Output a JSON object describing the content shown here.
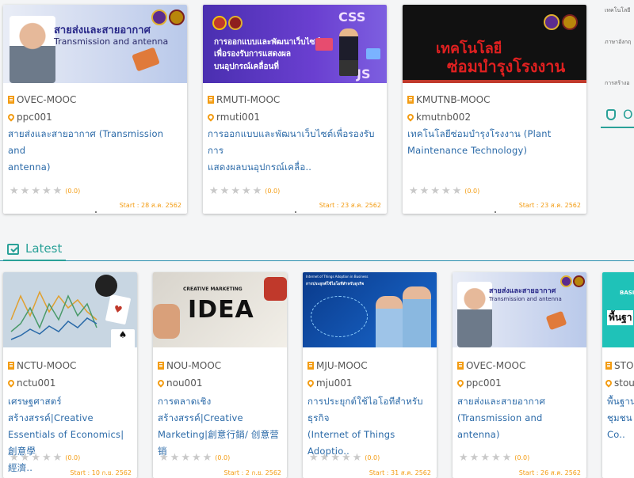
{
  "top_courses": [
    {
      "institution": "OVEC-MOOC",
      "code": "ppc001",
      "title_line1": "สายส่งและสายอากาศ (Transmission and",
      "title_line2": "antenna)",
      "rating": "(0.0)",
      "start": "Start : 28 ส.ค. 2562",
      "thumb_text1": "สายส่งและสายอากาศ",
      "thumb_text2": "Transmission and antenna"
    },
    {
      "institution": "RMUTI-MOOC",
      "code": "rmuti001",
      "title_line1": "การออกแบบและพัฒนาเว็บไซต์เพื่อรองรับการ",
      "title_line2": "แสดงผลบนอุปกรณ์เคลื่อ..",
      "rating": "(0.0)",
      "start": "Start : 23 ส.ค. 2562",
      "thumb_text1": "การออกแบบและพัฒนาเว็บไซต์",
      "thumb_text2": "เพื่อรองรับการแสดงผล",
      "thumb_text3": "บนอุปกรณ์เคลื่อนที่",
      "thumb_css": "CSS",
      "thumb_js": "JS"
    },
    {
      "institution": "KMUTNB-MOOC",
      "code": "kmutnb002",
      "title_line1": "เทคโนโลยีซ่อมบำรุงโรงงาน (Plant",
      "title_line2": "Maintenance Technology)",
      "rating": "(0.0)",
      "start": "Start : 23 ส.ค. 2562",
      "thumb_text1": "เทคโนโลยี",
      "thumb_text2": "ซ่อมบำรุงโรงงาน"
    }
  ],
  "side_panel": {
    "line1": "เทคโนโลยี",
    "line2": "ภาษาอังกฤ",
    "line3": "การสร้างอ",
    "online_label": "O"
  },
  "latest_section": {
    "title": "Latest"
  },
  "latest_courses": [
    {
      "institution": "NCTU-MOOC",
      "code": "nctu001",
      "title_line1": "เศรษฐศาสตร์สร้างสรรค์|Creative",
      "title_line2": "Essentials of Economics|創意學",
      "title_line3": "經濟..",
      "rating": "(0.0)",
      "start": "Start : 10 ก.ย. 2562"
    },
    {
      "institution": "NOU-MOOC",
      "code": "nou001",
      "title_line1": "การตลาดเชิงสร้างสรรค์|Creative",
      "title_line2": "Marketing|創意行銷/ 创意营销",
      "title_line3": "",
      "rating": "(0.0)",
      "start": "Start : 2 ก.ย. 2562",
      "thumb_idea": "IDEA",
      "thumb_creative": "CREATIVE MARKETING"
    },
    {
      "institution": "MJU-MOOC",
      "code": "mju001",
      "title_line1": "การประยุกต์ใช้ไอโอทีสำหรับธุรกิจ",
      "title_line2": "(Internet of Things Adoptio..",
      "title_line3": "",
      "rating": "(0.0)",
      "start": "Start : 31 ส.ค. 2562",
      "thumb_text1": "Internet of Things Adoption in Business",
      "thumb_text2": "การประยุกต์ใช้ไอโอทีสำหรับธุรกิจ"
    },
    {
      "institution": "OVEC-MOOC",
      "code": "ppc001",
      "title_line1": "สายส่งและสายอากาศ",
      "title_line2": "(Transmission and antenna)",
      "title_line3": "",
      "rating": "(0.0)",
      "start": "Start : 26 ส.ค. 2562",
      "thumb_text1": "สายส่งและสายอากาศ",
      "thumb_text2": "Transmission and antenna"
    },
    {
      "institution": "STO",
      "code": "stou.",
      "title_line1": "พื้นฐาน",
      "title_line2": "ชุมชน",
      "title_line3": "Co..",
      "rating": "",
      "start": "",
      "thumb_text1": "BASI",
      "thumb_text2": "พื้นฐา"
    }
  ],
  "colors": {
    "accent": "#2b6aa8",
    "orange": "#f39c12",
    "section_green": "#2aa198"
  }
}
